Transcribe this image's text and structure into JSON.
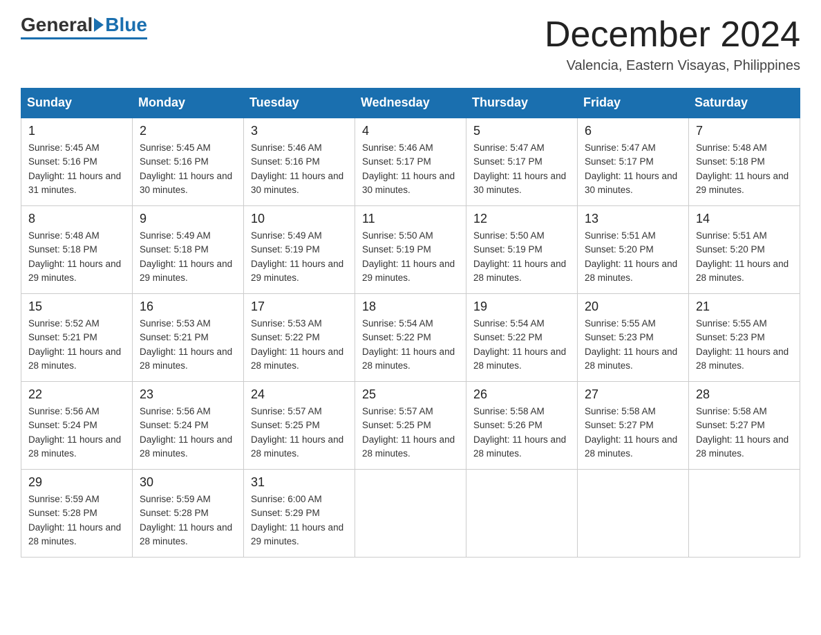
{
  "header": {
    "logo_general": "General",
    "logo_blue": "Blue",
    "month_title": "December 2024",
    "location": "Valencia, Eastern Visayas, Philippines"
  },
  "days_of_week": [
    "Sunday",
    "Monday",
    "Tuesday",
    "Wednesday",
    "Thursday",
    "Friday",
    "Saturday"
  ],
  "weeks": [
    [
      {
        "day": "1",
        "sunrise": "5:45 AM",
        "sunset": "5:16 PM",
        "daylight": "11 hours and 31 minutes."
      },
      {
        "day": "2",
        "sunrise": "5:45 AM",
        "sunset": "5:16 PM",
        "daylight": "11 hours and 30 minutes."
      },
      {
        "day": "3",
        "sunrise": "5:46 AM",
        "sunset": "5:16 PM",
        "daylight": "11 hours and 30 minutes."
      },
      {
        "day": "4",
        "sunrise": "5:46 AM",
        "sunset": "5:17 PM",
        "daylight": "11 hours and 30 minutes."
      },
      {
        "day": "5",
        "sunrise": "5:47 AM",
        "sunset": "5:17 PM",
        "daylight": "11 hours and 30 minutes."
      },
      {
        "day": "6",
        "sunrise": "5:47 AM",
        "sunset": "5:17 PM",
        "daylight": "11 hours and 30 minutes."
      },
      {
        "day": "7",
        "sunrise": "5:48 AM",
        "sunset": "5:18 PM",
        "daylight": "11 hours and 29 minutes."
      }
    ],
    [
      {
        "day": "8",
        "sunrise": "5:48 AM",
        "sunset": "5:18 PM",
        "daylight": "11 hours and 29 minutes."
      },
      {
        "day": "9",
        "sunrise": "5:49 AM",
        "sunset": "5:18 PM",
        "daylight": "11 hours and 29 minutes."
      },
      {
        "day": "10",
        "sunrise": "5:49 AM",
        "sunset": "5:19 PM",
        "daylight": "11 hours and 29 minutes."
      },
      {
        "day": "11",
        "sunrise": "5:50 AM",
        "sunset": "5:19 PM",
        "daylight": "11 hours and 29 minutes."
      },
      {
        "day": "12",
        "sunrise": "5:50 AM",
        "sunset": "5:19 PM",
        "daylight": "11 hours and 28 minutes."
      },
      {
        "day": "13",
        "sunrise": "5:51 AM",
        "sunset": "5:20 PM",
        "daylight": "11 hours and 28 minutes."
      },
      {
        "day": "14",
        "sunrise": "5:51 AM",
        "sunset": "5:20 PM",
        "daylight": "11 hours and 28 minutes."
      }
    ],
    [
      {
        "day": "15",
        "sunrise": "5:52 AM",
        "sunset": "5:21 PM",
        "daylight": "11 hours and 28 minutes."
      },
      {
        "day": "16",
        "sunrise": "5:53 AM",
        "sunset": "5:21 PM",
        "daylight": "11 hours and 28 minutes."
      },
      {
        "day": "17",
        "sunrise": "5:53 AM",
        "sunset": "5:22 PM",
        "daylight": "11 hours and 28 minutes."
      },
      {
        "day": "18",
        "sunrise": "5:54 AM",
        "sunset": "5:22 PM",
        "daylight": "11 hours and 28 minutes."
      },
      {
        "day": "19",
        "sunrise": "5:54 AM",
        "sunset": "5:22 PM",
        "daylight": "11 hours and 28 minutes."
      },
      {
        "day": "20",
        "sunrise": "5:55 AM",
        "sunset": "5:23 PM",
        "daylight": "11 hours and 28 minutes."
      },
      {
        "day": "21",
        "sunrise": "5:55 AM",
        "sunset": "5:23 PM",
        "daylight": "11 hours and 28 minutes."
      }
    ],
    [
      {
        "day": "22",
        "sunrise": "5:56 AM",
        "sunset": "5:24 PM",
        "daylight": "11 hours and 28 minutes."
      },
      {
        "day": "23",
        "sunrise": "5:56 AM",
        "sunset": "5:24 PM",
        "daylight": "11 hours and 28 minutes."
      },
      {
        "day": "24",
        "sunrise": "5:57 AM",
        "sunset": "5:25 PM",
        "daylight": "11 hours and 28 minutes."
      },
      {
        "day": "25",
        "sunrise": "5:57 AM",
        "sunset": "5:25 PM",
        "daylight": "11 hours and 28 minutes."
      },
      {
        "day": "26",
        "sunrise": "5:58 AM",
        "sunset": "5:26 PM",
        "daylight": "11 hours and 28 minutes."
      },
      {
        "day": "27",
        "sunrise": "5:58 AM",
        "sunset": "5:27 PM",
        "daylight": "11 hours and 28 minutes."
      },
      {
        "day": "28",
        "sunrise": "5:58 AM",
        "sunset": "5:27 PM",
        "daylight": "11 hours and 28 minutes."
      }
    ],
    [
      {
        "day": "29",
        "sunrise": "5:59 AM",
        "sunset": "5:28 PM",
        "daylight": "11 hours and 28 minutes."
      },
      {
        "day": "30",
        "sunrise": "5:59 AM",
        "sunset": "5:28 PM",
        "daylight": "11 hours and 28 minutes."
      },
      {
        "day": "31",
        "sunrise": "6:00 AM",
        "sunset": "5:29 PM",
        "daylight": "11 hours and 29 minutes."
      },
      null,
      null,
      null,
      null
    ]
  ]
}
